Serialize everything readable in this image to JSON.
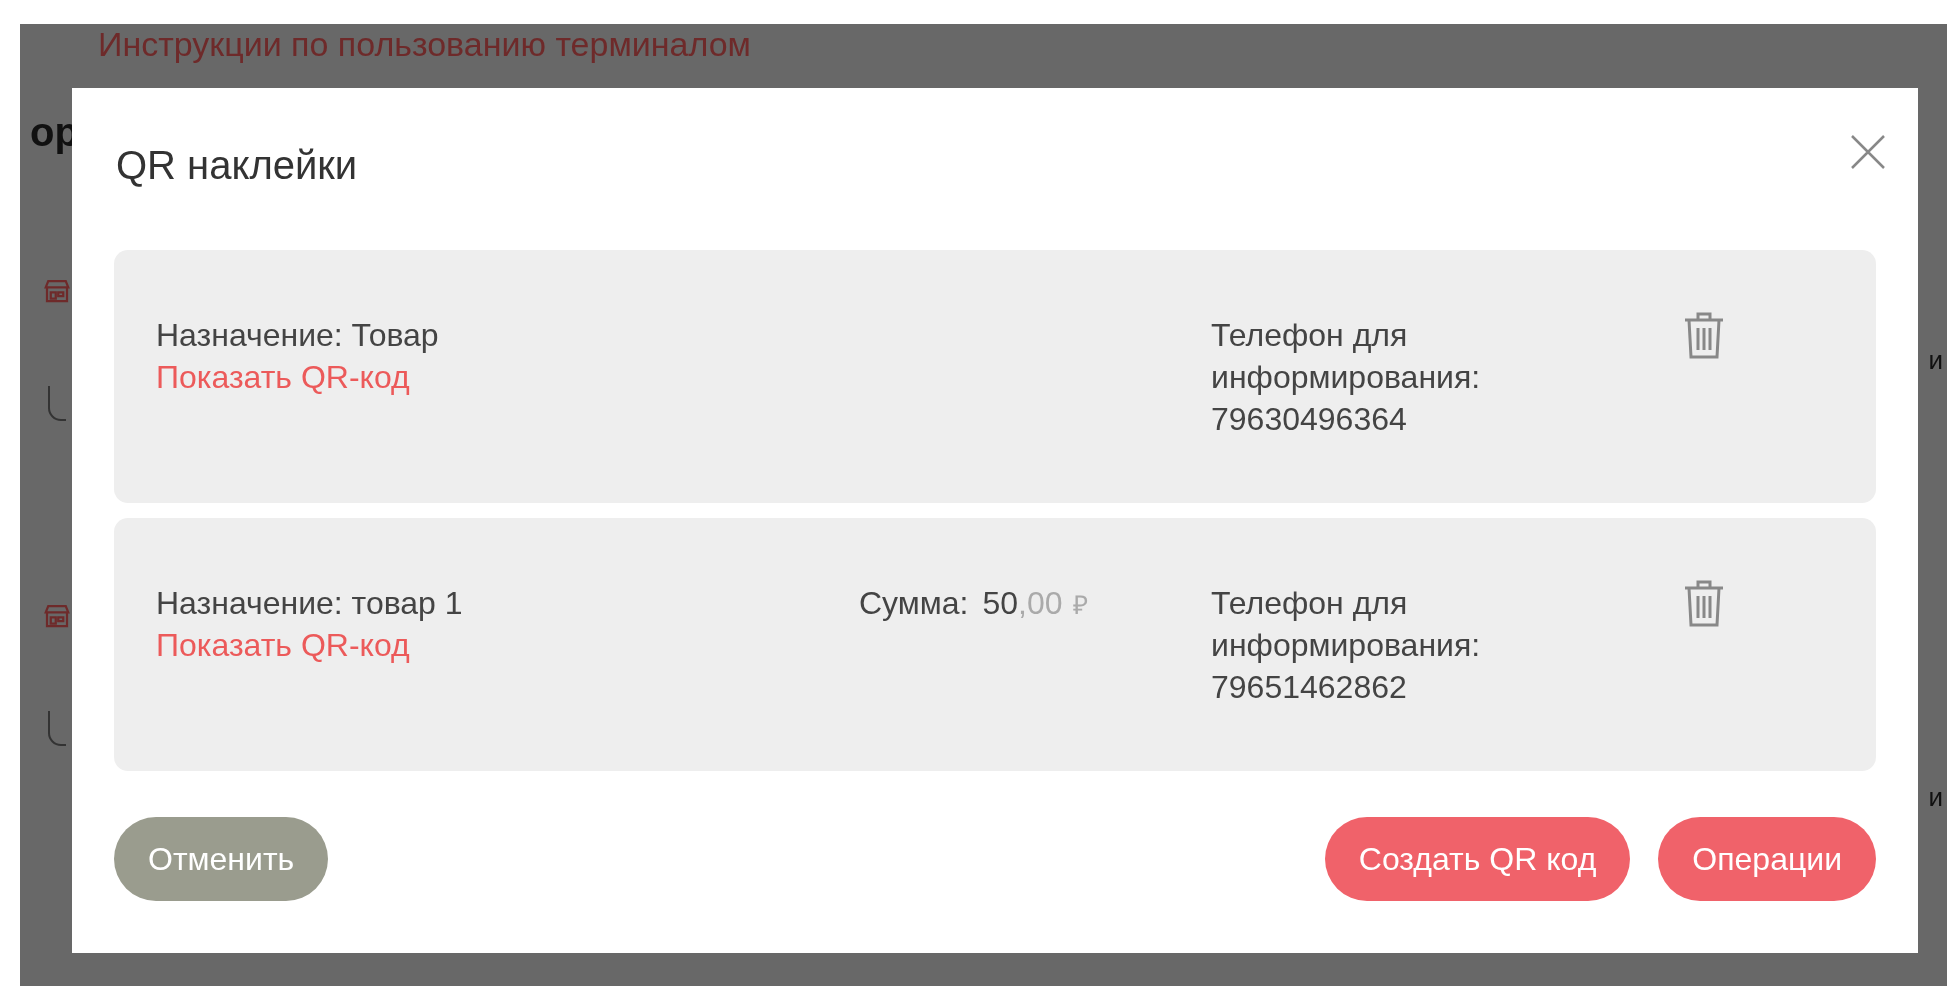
{
  "background": {
    "link": "Инструкции по пользованию терминалом",
    "heading_fragment": "ор",
    "right_fragments": [
      "и",
      "и"
    ]
  },
  "dialog": {
    "title": "QR наклейки",
    "stickers": [
      {
        "purpose": "Назначение: Товар",
        "show_qr": "Показать QR-код",
        "phone_label": "Телефон для информирования:",
        "phone": "79630496364"
      },
      {
        "purpose": "Назначение: товар 1",
        "show_qr": "Показать QR-код",
        "sum_label": "Сумма:",
        "sum_whole": "50",
        "sum_fraction": ",00",
        "currency": "₽",
        "phone_label": "Телефон для информирования:",
        "phone": "79651462862"
      }
    ],
    "buttons": [
      {
        "label": "Отменить",
        "kind": "secondary"
      },
      {
        "label": "Создать QR код",
        "kind": "primary"
      },
      {
        "label": "Операции",
        "kind": "primary"
      }
    ]
  }
}
